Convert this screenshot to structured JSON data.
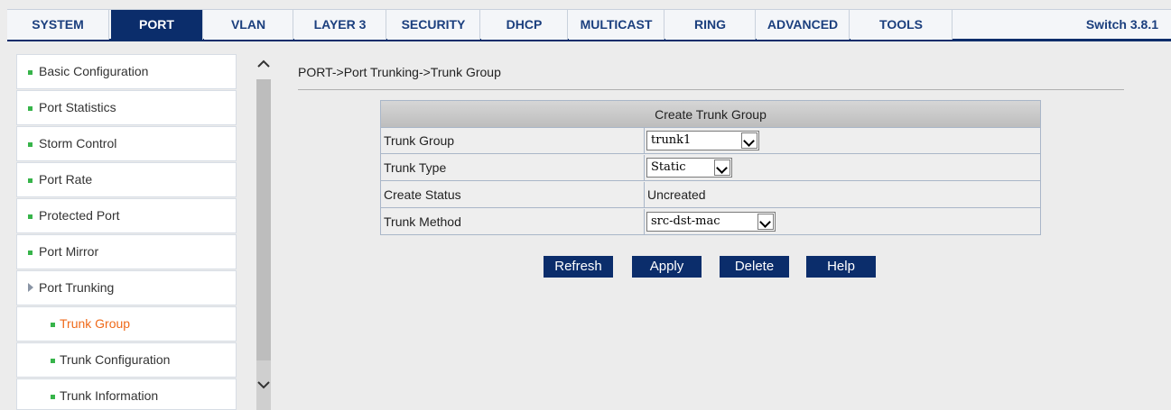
{
  "nav": {
    "tabs": [
      "SYSTEM",
      "PORT",
      "VLAN",
      "LAYER 3",
      "SECURITY",
      "DHCP",
      "MULTICAST",
      "RING",
      "ADVANCED",
      "TOOLS"
    ],
    "active_tab": "PORT",
    "version": "Switch 3.8.1"
  },
  "sidebar": {
    "items": [
      {
        "label": "Basic Configuration"
      },
      {
        "label": "Port Statistics"
      },
      {
        "label": "Storm Control"
      },
      {
        "label": "Port Rate"
      },
      {
        "label": "Protected Port"
      },
      {
        "label": "Port Mirror"
      },
      {
        "label": "Port Trunking"
      },
      {
        "label": "Trunk Group"
      },
      {
        "label": "Trunk Configuration"
      },
      {
        "label": "Trunk Information"
      }
    ],
    "selected": "Trunk Group"
  },
  "scrollbar": {
    "up_glyph": "^",
    "down_glyph": "v"
  },
  "main": {
    "breadcrumb": "PORT->Port Trunking->Trunk Group",
    "form": {
      "title": "Create Trunk Group",
      "rows": [
        {
          "label": "Trunk Group",
          "value": "trunk1"
        },
        {
          "label": "Trunk Type",
          "value": "Static"
        },
        {
          "label": "Create Status",
          "value": "Uncreated"
        },
        {
          "label": "Trunk Method",
          "value": "src-dst-mac"
        }
      ]
    },
    "buttons": {
      "refresh": "Refresh",
      "apply": "Apply",
      "delete": "Delete",
      "help": "Help"
    }
  },
  "colors": {
    "nav_active": "#0b2d6b",
    "nav_text": "#1b3f7e",
    "bullet_green": "#37b44a",
    "selected_orange": "#ef6a1a",
    "button_bg": "#0b2d6b"
  }
}
